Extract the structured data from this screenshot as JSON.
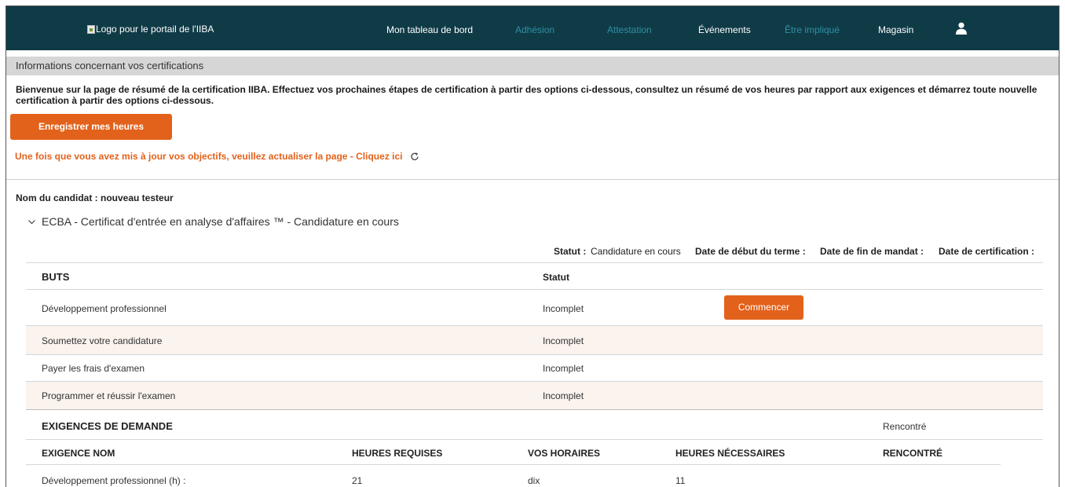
{
  "nav": {
    "logo_alt": "Logo pour le portail de l'IIBA",
    "items": [
      {
        "label": "Mon tableau de bord",
        "muted": false
      },
      {
        "label": "Adhésion",
        "muted": true
      },
      {
        "label": "Attestation",
        "muted": true
      },
      {
        "label": "Événements",
        "muted": false
      },
      {
        "label": "Être impliqué",
        "muted": true
      },
      {
        "label": "Magasin",
        "muted": false
      }
    ],
    "user_icon": "user-icon"
  },
  "section_title": "Informations concernant vos certifications",
  "welcome_text": "Bienvenue sur la page de résumé de la certification IIBA. Effectuez vos prochaines étapes de certification à partir des options ci-dessous, consultez un résumé de vos heures par rapport aux exigences et démarrez toute nouvelle certification à partir des options ci-dessous.",
  "log_hours_button": "Enregistrer mes heures",
  "refresh_text": "Une fois que vous avez mis à jour vos objectifs, veuillez actualiser la page - Cliquez ici",
  "candidate_name": "Nom du candidat : nouveau testeur",
  "certification": {
    "title": "ECBA - Certificat d'entrée en analyse d'affaires ™ - Candidature en cours",
    "status_label": "Statut :",
    "status_value": "Candidature en cours",
    "term_start_label": "Date de début du terme :",
    "term_end_label": "Date de fin de mandat :",
    "cert_date_label": "Date de certification :"
  },
  "goals": {
    "header": "BUTS",
    "status_header": "Statut",
    "start_button": "Commencer",
    "rows": [
      {
        "name": "Développement professionnel",
        "status": "Incomplet"
      },
      {
        "name": "Soumettez votre candidature",
        "status": "Incomplet"
      },
      {
        "name": "Payer les frais d'examen",
        "status": "Incomplet"
      },
      {
        "name": "Programmer et réussir l'examen",
        "status": "Incomplet"
      }
    ]
  },
  "requirements": {
    "header": "EXIGENCES DE DEMANDE",
    "met_header": "Rencontré",
    "columns": [
      "EXIGENCE NOM",
      "HEURES REQUISES",
      "VOS HORAIRES",
      "HEURES NÉCESSAIRES",
      "RENCONTRÉ"
    ],
    "rows": [
      {
        "name": "Développement professionnel (h) :",
        "required": "21",
        "yours": "dix",
        "needed": "11",
        "met": ""
      }
    ]
  },
  "colors": {
    "nav_bg": "#0f3b47",
    "accent": "#e2621b",
    "muted_nav": "#2f8fa2",
    "alt_row": "#faf3ee"
  }
}
